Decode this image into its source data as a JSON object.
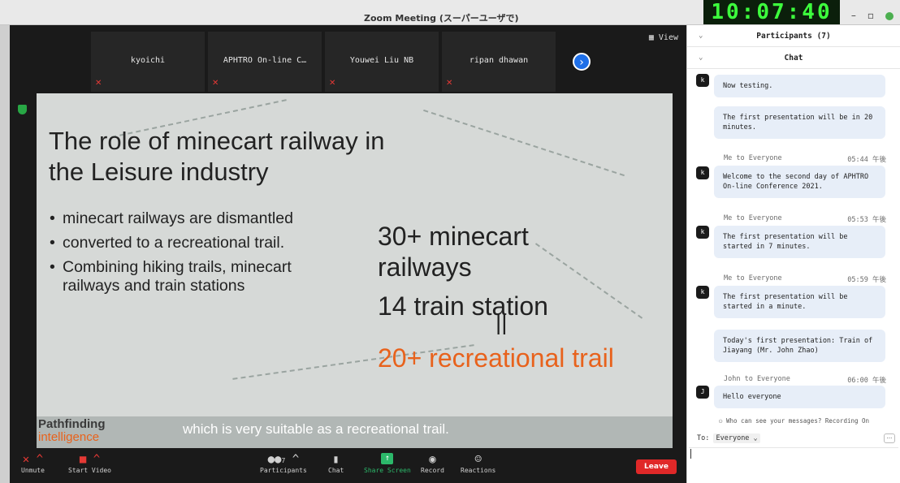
{
  "window": {
    "title": "Zoom Meeting (スーパーユーザで)",
    "clock": "10:07:40"
  },
  "thumbnails": [
    {
      "name": "kyoichi"
    },
    {
      "name": "APHTRO On-line C…"
    },
    {
      "name": "Youwei Liu NB"
    },
    {
      "name": "ripan dhawan"
    }
  ],
  "view_label": "View",
  "slide": {
    "title_line1": "The role of minecart railway in",
    "title_line2": "the Leisure industry",
    "bullets": [
      "minecart railways are dismantled",
      "converted to a recreational trail.",
      "Combining hiking trails, minecart railways  and train stations"
    ],
    "big1": "30+ minecart",
    "big2": "railways",
    "big3": "14 train station",
    "eq": "||",
    "orange": "20+ recreational trail",
    "brand1": "Pathfinding",
    "brand2": "intelligence",
    "caption": "which is very suitable as a recreational trail."
  },
  "toolbar": {
    "unmute": "Unmute",
    "start_video": "Start Video",
    "participants": "Participants",
    "participants_count": "7",
    "chat": "Chat",
    "share": "Share Screen",
    "record": "Record",
    "reactions": "Reactions",
    "leave": "Leave"
  },
  "panel": {
    "participants_header": "Participants (7)",
    "chat_header": "Chat",
    "messages": [
      {
        "text": "Now testing."
      },
      {
        "text": "The first presentation will be in 20 minutes."
      },
      {
        "sender": "Me to Everyone",
        "time": "05:44 午後",
        "text": "Welcome to the second day of APHTRO On-line Conference 2021."
      },
      {
        "sender": "Me to Everyone",
        "time": "05:53 午後",
        "text": "The first presentation will be started in 7 minutes."
      },
      {
        "sender": "Me to Everyone",
        "time": "05:59 午後",
        "text": "The first presentation will be started in a minute."
      },
      {
        "text": "Today's first presentation: Train of Jiayang (Mr. John Zhao)"
      },
      {
        "sender": "John to Everyone",
        "time": "06:00 午後",
        "text": "Hello everyone"
      }
    ],
    "avatar_k": "k",
    "avatar_j": "J",
    "notice": "Who can see your messages? Recording On",
    "to_label": "To:",
    "to_value": "Everyone"
  }
}
